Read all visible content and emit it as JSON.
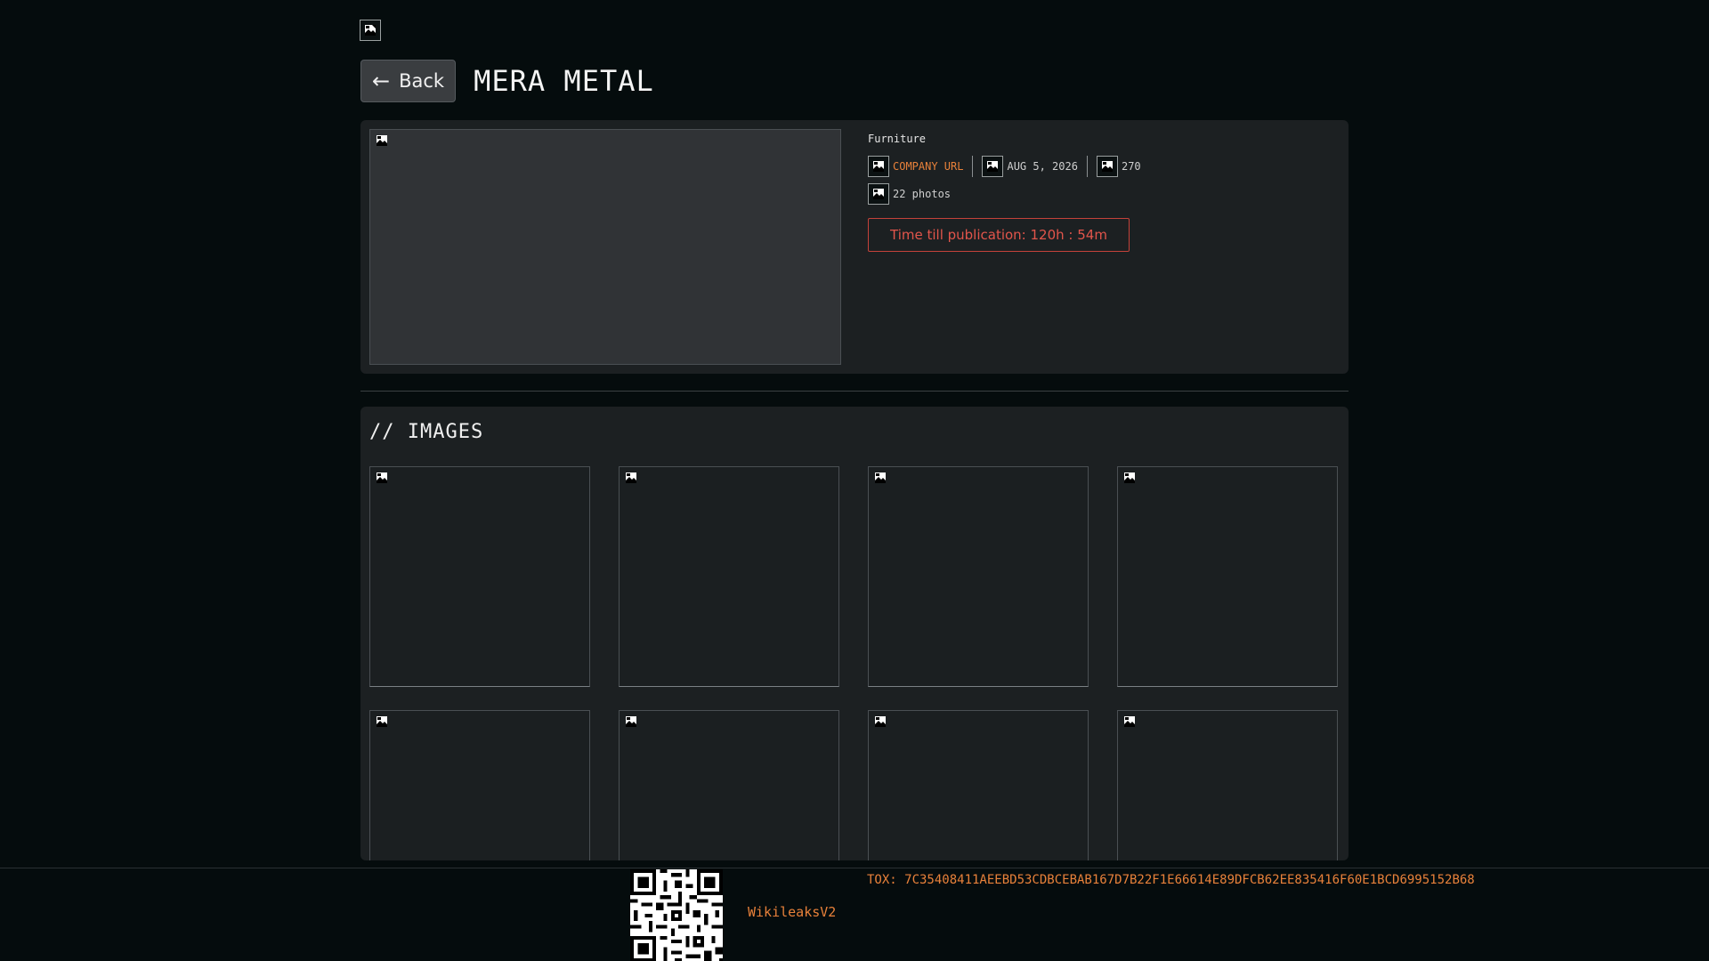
{
  "header": {
    "back_label": "Back",
    "title": "MERA METAL"
  },
  "company": {
    "category": "Furniture",
    "url_label": "COMPANY URL",
    "date": "AUG 5, 2026",
    "views": "270",
    "photos": "22 photos",
    "countdown": "Time till publication: 120h : 54m"
  },
  "images_section": {
    "title": "// IMAGES"
  },
  "footer": {
    "name": "WikileaksV2",
    "tox": "TOX: 7C35408411AEEBD53CDBCEBAB167D7B22F1E66614E89DFCB62EE835416F60E1BCD6995152B68"
  },
  "colors": {
    "background": "#050c0d",
    "card": "#1c2022",
    "accent": "#e8813a",
    "alert": "#e2554b"
  },
  "icons": {
    "placeholder": "broken-image-icon",
    "back": "arrow-left-icon"
  }
}
